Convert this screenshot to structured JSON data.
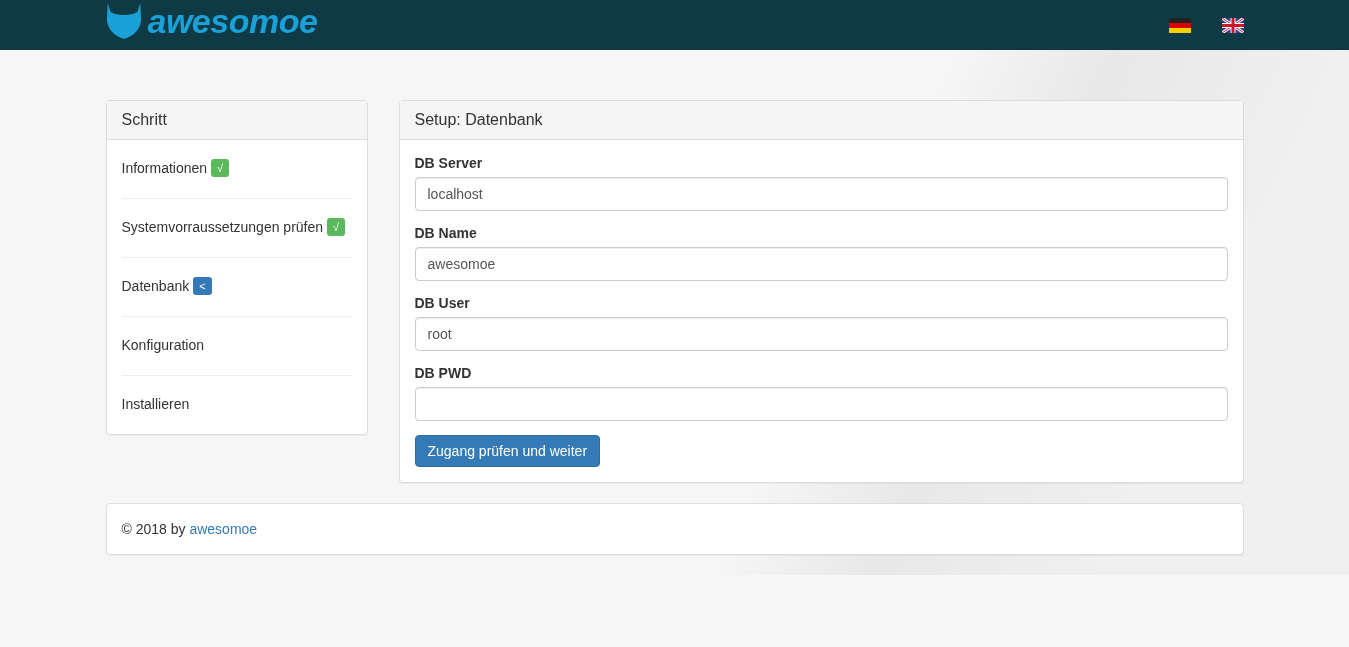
{
  "navbar": {
    "brand": "awesomoe",
    "languages": [
      {
        "kind": "de"
      },
      {
        "kind": "en"
      }
    ]
  },
  "steps": {
    "title": "Schritt",
    "items": [
      {
        "label": "Informationen",
        "kind": "done",
        "badge": "√"
      },
      {
        "label": "Systemvorraussetzungen prüfen",
        "kind": "done",
        "badge": "√"
      },
      {
        "label": "Datenbank",
        "kind": "current",
        "badge": "<"
      },
      {
        "label": "Konfiguration",
        "kind": "pending"
      },
      {
        "label": "Installieren",
        "kind": "pending"
      }
    ]
  },
  "setup": {
    "title": "Setup: Datenbank",
    "fields": [
      {
        "label": "DB Server",
        "value": "localhost"
      },
      {
        "label": "DB Name",
        "value": "awesomoe"
      },
      {
        "label": "DB User",
        "value": "root"
      },
      {
        "label": "DB PWD"
      }
    ],
    "button": "Zugang prüfen und weiter"
  },
  "footer": {
    "text": "© 2018 by",
    "link": "awesomoe"
  }
}
